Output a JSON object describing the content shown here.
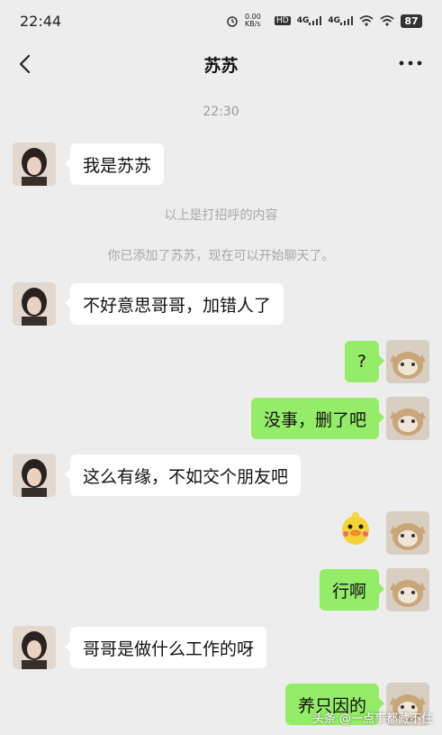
{
  "status_bar": {
    "time": "22:44",
    "speed": "0.00 KB/s",
    "hd": "HD",
    "signal_1": "4G",
    "signal_2": "4G",
    "battery": "87"
  },
  "nav": {
    "title": "苏苏",
    "back_icon": "chevron-left-icon",
    "more_icon": "more-dots-icon"
  },
  "chat": {
    "timestamp": "22:30",
    "system_messages": [
      "以上是打招呼的内容",
      "你已添加了苏苏，现在可以开始聊天了。"
    ],
    "messages": [
      {
        "side": "left",
        "text": "我是苏苏"
      },
      {
        "side": "left",
        "text": "不好意思哥哥，加错人了"
      },
      {
        "side": "right",
        "text": "?"
      },
      {
        "side": "right",
        "text": "没事，删了吧"
      },
      {
        "side": "left",
        "text": "这么有缘，不如交个朋友吧"
      },
      {
        "side": "right",
        "text": "",
        "sticker": "duck-sticker-icon"
      },
      {
        "side": "right",
        "text": "行啊"
      },
      {
        "side": "left",
        "text": "哥哥是做什么工作的呀"
      },
      {
        "side": "right",
        "text": "养只因的"
      }
    ]
  },
  "watermark": "头条 @一点事都藏不住",
  "colors": {
    "background": "#ededed",
    "right_bubble": "#95ec69",
    "left_bubble": "#ffffff"
  }
}
